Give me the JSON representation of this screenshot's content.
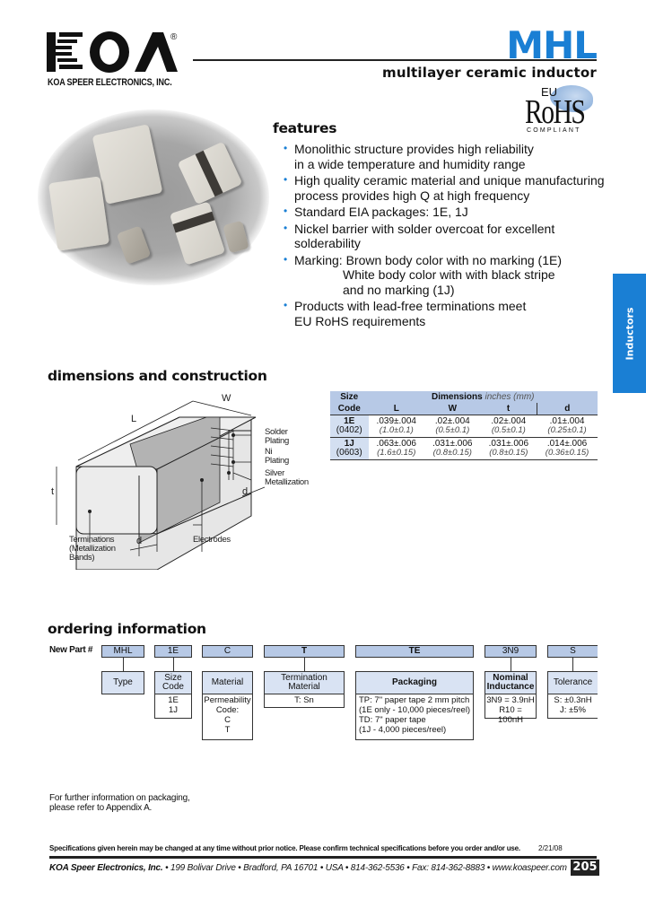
{
  "header": {
    "brand": "KOA",
    "registered_mark": "®",
    "company": "KOA SPEER ELECTRONICS, INC.",
    "product_code": "MHL",
    "product_name": "multilayer ceramic inductor",
    "rohs": {
      "eu": "EU",
      "mark": "RoHS",
      "compliant": "COMPLIANT"
    }
  },
  "side_tab": "Inductors",
  "features": {
    "heading": "features",
    "items": [
      {
        "line1": "Monolithic structure provides high reliability",
        "line2": "in a wide temperature and humidity range"
      },
      {
        "line1": "High quality ceramic material and unique manufacturing",
        "line2": "process provides high Q at high frequency"
      },
      {
        "line1": "Standard EIA packages: 1E, 1J"
      },
      {
        "line1": "Nickel barrier with solder overcoat for excellent",
        "line2": "solderability"
      },
      {
        "line1": "Marking: Brown body color with no marking (1E)",
        "line2": "White body color with with black stripe",
        "line3": "and no marking (1J)"
      },
      {
        "line1": "Products with lead-free terminations meet",
        "line2": "EU RoHS requirements"
      }
    ]
  },
  "dimensions": {
    "heading": "dimensions and construction",
    "diagram_labels": {
      "L": "L",
      "W": "W",
      "t": "t",
      "d": "d",
      "solder": "Solder\nPlating",
      "ni": "Ni\nPlating",
      "silver": "Silver\nMetallization",
      "terminations": "Terminations\n(Metallization\nBands)",
      "electrodes": "Electrodes"
    },
    "table": {
      "size_header": "Size",
      "code_header": "Code",
      "dims_header": "Dimensions",
      "units": "inches (mm)",
      "columns": [
        "L",
        "W",
        "t",
        "d"
      ],
      "rows": [
        {
          "code": "1E",
          "eia": "(0402)",
          "in": [
            ".039±.004",
            ".02±.004",
            ".02±.004",
            ".01±.004"
          ],
          "mm": [
            "(1.0±0.1)",
            "(0.5±0.1)",
            "(0.5±0.1)",
            "(0.25±0.1)"
          ]
        },
        {
          "code": "1J",
          "eia": "(0603)",
          "in": [
            ".063±.006",
            ".031±.006",
            ".031±.006",
            ".014±.006"
          ],
          "mm": [
            "(1.6±0.15)",
            "(0.8±0.15)",
            "(0.8±0.15)",
            "(0.36±0.15)"
          ]
        }
      ]
    }
  },
  "ordering": {
    "heading": "ordering information",
    "new_part_label": "New Part #",
    "fields": [
      {
        "code": "MHL",
        "label": "Type",
        "values": []
      },
      {
        "code": "1E",
        "label": "Size\nCode",
        "values": [
          "1E",
          "1J"
        ]
      },
      {
        "code": "C",
        "label": "Material",
        "values": [
          "Permeability",
          "Code:",
          "C",
          "T"
        ]
      },
      {
        "code": "T",
        "label": "Termination\nMaterial",
        "values": [
          "T: Sn"
        ]
      },
      {
        "code": "TE",
        "label": "Packaging",
        "values": [
          "TP: 7\" paper tape 2 mm pitch",
          "(1E only - 10,000 pieces/reel)",
          "TD: 7\" paper tape",
          "(1J - 4,000 pieces/reel)"
        ]
      },
      {
        "code": "3N9",
        "label": "Nominal\nInductance",
        "values": [
          "3N9 = 3.9nH",
          "R10 = 100nH"
        ]
      },
      {
        "code": "S",
        "label": "Tolerance",
        "values": [
          "S: ±0.3nH",
          "J: ±5%"
        ]
      }
    ],
    "note": "For further information on packaging,\nplease refer to Appendix A."
  },
  "footer": {
    "disclaimer": "Specifications given herein may be changed at any time without prior notice. Please confirm technical specifications before you order and/or use.",
    "date": "2/21/08",
    "company": "KOA Speer Electronics, Inc.",
    "address": " • 199 Bolivar Drive • Bradford, PA 16701 • USA • 814-362-5536 • Fax: 814-362-8883 • www.koaspeer.com",
    "page": "205"
  },
  "colors": {
    "accent": "#1a7fd4",
    "table_header": "#b7c9e6",
    "table_code": "#d3dff1"
  }
}
